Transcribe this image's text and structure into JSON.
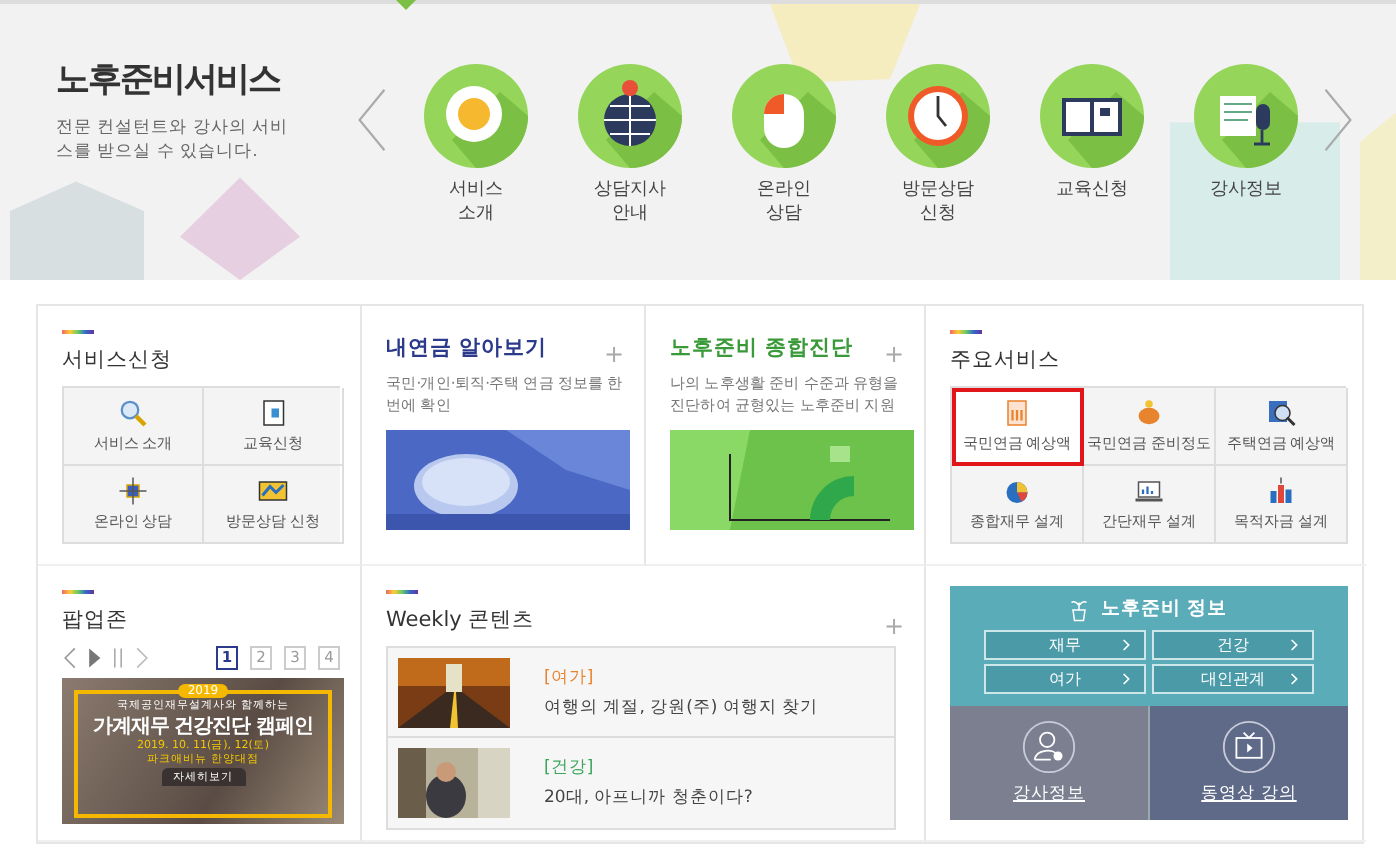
{
  "banner": {
    "title": "노후준비서비스",
    "description": "전문 컨설턴트와 강사의 서비스를 받으실 수 있습니다.",
    "services": [
      {
        "label": "서비스\n소개",
        "kind": "egg"
      },
      {
        "label": "상담지사\n안내",
        "kind": "globe"
      },
      {
        "label": "온라인\n상담",
        "kind": "mouse"
      },
      {
        "label": "방문상담\n신청",
        "kind": "clock"
      },
      {
        "label": "교육신청",
        "kind": "book"
      },
      {
        "label": "강사정보",
        "kind": "mic"
      }
    ]
  },
  "service_request": {
    "title": "서비스신청",
    "items": [
      {
        "label": "서비스 소개",
        "kind": "search"
      },
      {
        "label": "교육신청",
        "kind": "book"
      },
      {
        "label": "온라인 상담",
        "kind": "network"
      },
      {
        "label": "방문상담 신청",
        "kind": "map"
      }
    ]
  },
  "pension_lookup": {
    "title": "내연금 알아보기",
    "more": "+",
    "description": "국민·개인·퇴직·주택 연금 정보를 한 번에 확인"
  },
  "retirement_check": {
    "title": "노후준비 종합진단",
    "more": "+",
    "description": "나의 노후생활 준비 수준과 유형을 진단하여 균형있는 노후준비 지원"
  },
  "main_services": {
    "title": "주요서비스",
    "items": [
      {
        "label": "국민연금 예상액",
        "kind": "calc",
        "selected": true
      },
      {
        "label": "국민연금 준비정도",
        "kind": "pig",
        "selected": false
      },
      {
        "label": "주택연금 예상액",
        "kind": "magnifier",
        "selected": false
      },
      {
        "label": "종합재무 설계",
        "kind": "pie",
        "selected": false
      },
      {
        "label": "간단재무 설계",
        "kind": "laptop",
        "selected": false
      },
      {
        "label": "목적자금 설계",
        "kind": "bars",
        "selected": false
      }
    ]
  },
  "popup_zone": {
    "title": "팝업존",
    "pages": [
      {
        "label": "1",
        "selected": true
      },
      {
        "label": "2",
        "selected": false
      },
      {
        "label": "3",
        "selected": false
      },
      {
        "label": "4",
        "selected": false
      }
    ],
    "banner": {
      "year": "2019",
      "subtitle": "국제공인재무설계사와 함께하는",
      "headline": "가계재무 건강진단 캠페인",
      "date": "2019. 10. 11(금), 12(토)",
      "venue": "파크애비뉴 한양대점",
      "button": "자세히보기"
    }
  },
  "weekly": {
    "title": "Weekly 콘텐츠",
    "more": "+",
    "items": [
      {
        "category": "[여가]",
        "text": "여행의 계절, 강원(주) 여행지 찾기",
        "color": "#e8832e",
        "kind": "autumn"
      },
      {
        "category": "[건강]",
        "text": "20대, 아프니까 청춘이다?",
        "color": "#3aa55a",
        "kind": "room"
      }
    ]
  },
  "retirement_info": {
    "title": "노후준비 정보",
    "links": [
      "재무",
      "건강",
      "여가",
      "대인관계"
    ],
    "tiles": [
      {
        "label": "강사정보",
        "kind": "person"
      },
      {
        "label": "동영상 강의",
        "kind": "tv"
      }
    ]
  }
}
